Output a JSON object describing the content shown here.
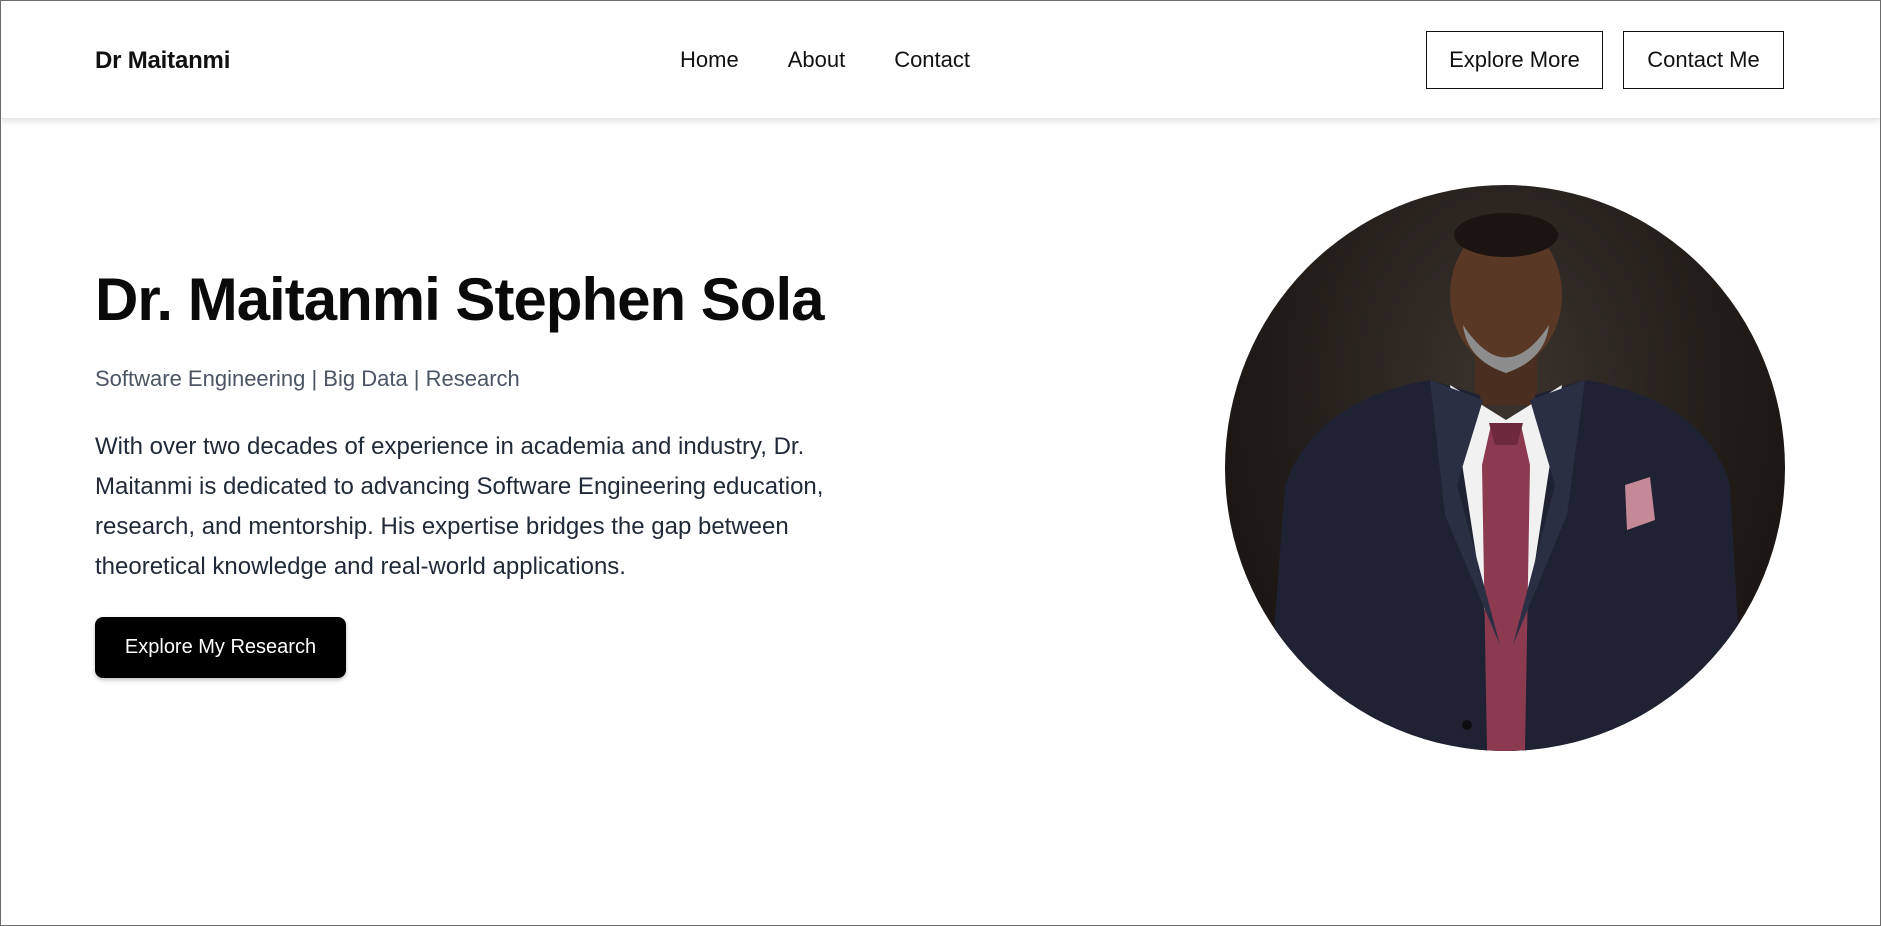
{
  "header": {
    "brand": "Dr Maitanmi",
    "nav": [
      {
        "label": "Home"
      },
      {
        "label": "About"
      },
      {
        "label": "Contact"
      }
    ],
    "explore_more_label": "Explore More",
    "contact_me_label": "Contact Me"
  },
  "hero": {
    "title": "Dr. Maitanmi Stephen Sola",
    "subtitle": "Software Engineering | Big Data | Research",
    "description": "With over two decades of experience in academia and industry, Dr. Maitanmi is dedicated to advancing Software Engineering education, research, and mentorship. His expertise bridges the gap between theoretical knowledge and real-world applications.",
    "cta_label": "Explore My Research"
  },
  "colors": {
    "background": "#ffffff",
    "text": "#111111",
    "subtitle": "#4b5563",
    "button": "#000000"
  }
}
